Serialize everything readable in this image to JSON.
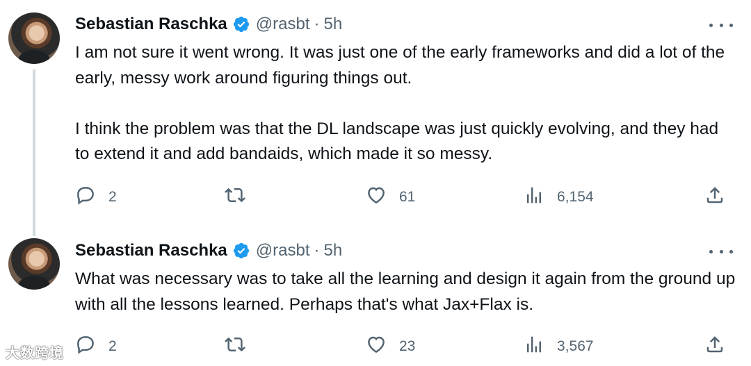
{
  "tweets": [
    {
      "name": "Sebastian Raschka",
      "handle": "@rasbt",
      "separator": "·",
      "time": "5h",
      "text": "I am not sure it went wrong. It was just one of the early frameworks and did a lot of the early, messy work around figuring things out.\n\nI think the problem was that the DL landscape was just quickly evolving, and they had to extend it and add bandaids, which made it so messy.",
      "replies": "2",
      "retweets": "",
      "likes": "61",
      "views": "6,154"
    },
    {
      "name": "Sebastian Raschka",
      "handle": "@rasbt",
      "separator": "·",
      "time": "5h",
      "text": "What was necessary was to take all the learning and design it again from the ground up with all the lessons learned. Perhaps that's what Jax+Flax is.",
      "replies": "2",
      "retweets": "",
      "likes": "23",
      "views": "3,567"
    }
  ],
  "icons": {
    "verified": "verified-badge-icon",
    "reply": "reply-icon",
    "retweet": "retweet-icon",
    "like": "heart-icon",
    "views": "views-icon",
    "share": "share-icon",
    "more": "more-icon"
  },
  "colors": {
    "verified": "#1d9bf0",
    "muted": "#536471",
    "text": "#0f1419",
    "thread": "#cfd9de"
  },
  "watermark": "大数跨境"
}
